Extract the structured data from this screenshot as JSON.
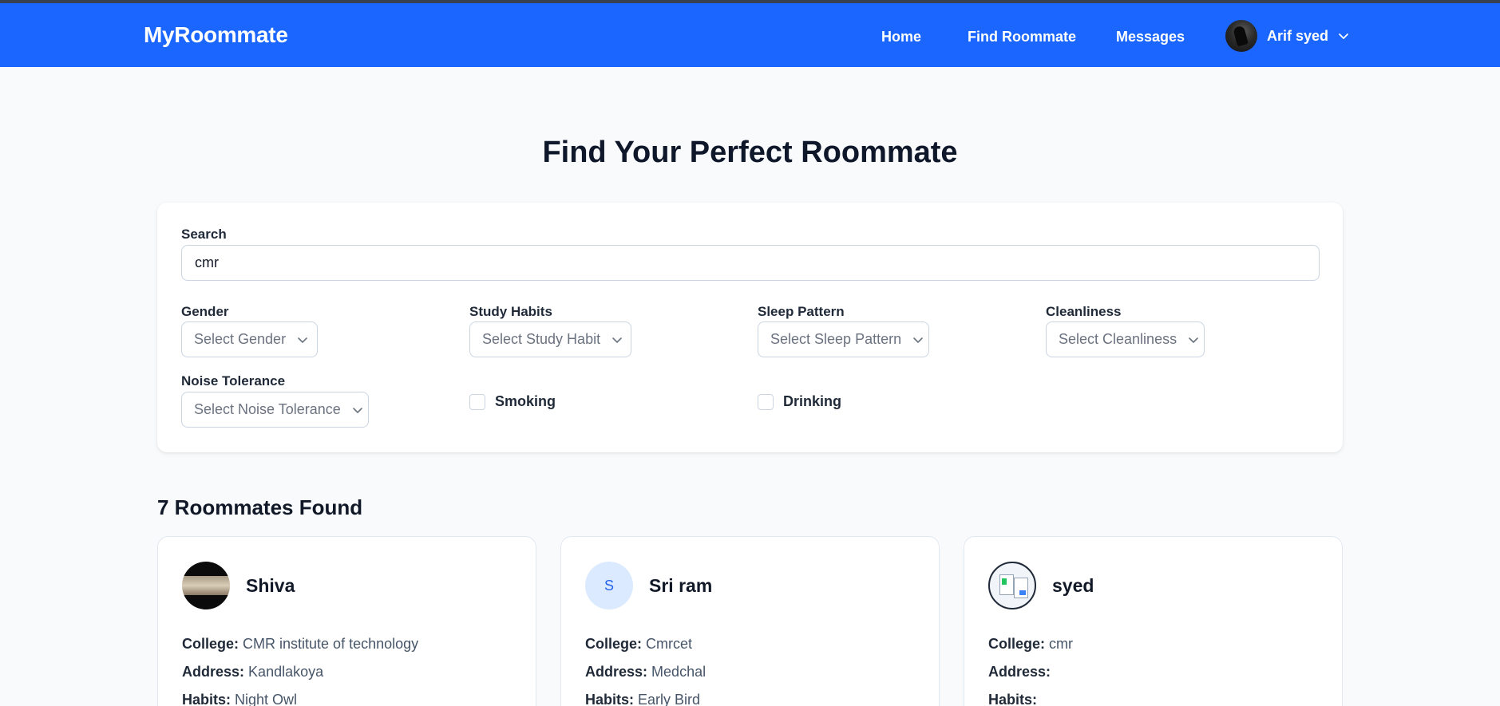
{
  "brand": "MyRoommate",
  "nav": {
    "links": [
      "Home",
      "Find Roommate",
      "Messages"
    ],
    "user_name": "Arif syed"
  },
  "page_title": "Find Your Perfect Roommate",
  "filters": {
    "search_label": "Search",
    "search_value": "cmr",
    "gender": {
      "label": "Gender",
      "placeholder": "Select Gender"
    },
    "study_habits": {
      "label": "Study Habits",
      "placeholder": "Select Study Habit"
    },
    "sleep_pattern": {
      "label": "Sleep Pattern",
      "placeholder": "Select Sleep Pattern"
    },
    "cleanliness": {
      "label": "Cleanliness",
      "placeholder": "Select Cleanliness"
    },
    "noise_tolerance": {
      "label": "Noise Tolerance",
      "placeholder": "Select Noise Tolerance"
    },
    "smoking_label": "Smoking",
    "smoking_checked": false,
    "drinking_label": "Drinking",
    "drinking_checked": false
  },
  "results": {
    "title": "7 Roommates Found",
    "field_labels": {
      "college": "College:",
      "address": "Address:",
      "habits": "Habits:"
    },
    "cards": [
      {
        "name": "Shiva",
        "avatar": "photo",
        "college": "CMR institute of technology",
        "address": "Kandlakoya",
        "habits": "Night Owl"
      },
      {
        "name": "Sri ram",
        "avatar": "initial",
        "initial": "S",
        "college": "Cmrcet",
        "address": "Medchal",
        "habits": "Early Bird"
      },
      {
        "name": "syed",
        "avatar": "photo",
        "college": "cmr",
        "address": "",
        "habits": ""
      }
    ]
  },
  "colors": {
    "navbar": "#1a66ff",
    "background": "#f8fafc",
    "initial_avatar_bg": "#dbeafe",
    "initial_avatar_text": "#2563eb"
  },
  "icons": [
    "chevron-down-icon",
    "user-avatar"
  ]
}
